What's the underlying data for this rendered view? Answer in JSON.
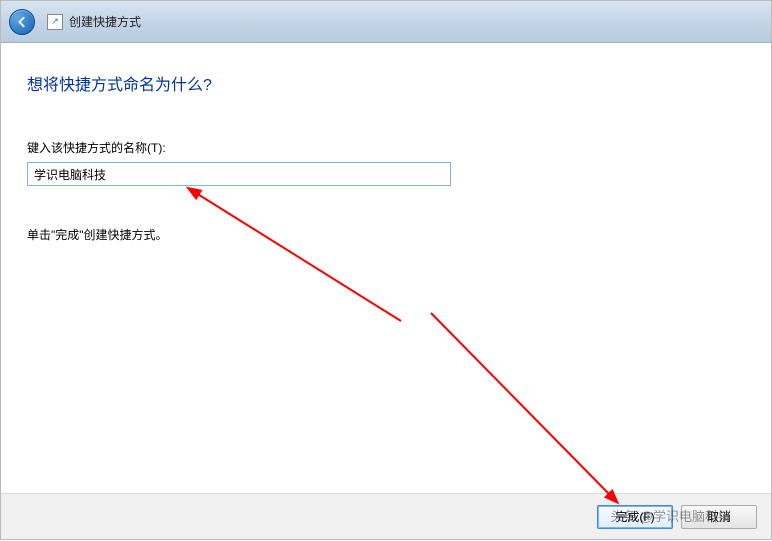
{
  "titlebar": {
    "title": "创建快捷方式"
  },
  "wizard": {
    "heading": "想将快捷方式命名为什么?",
    "name_label": "键入该快捷方式的名称(T):",
    "name_value": "学识电脑科技",
    "hint": "单击\"完成\"创建快捷方式。"
  },
  "buttons": {
    "finish": "完成(F)",
    "cancel": "取消"
  },
  "watermark": {
    "text": "头条 @学识电脑科技"
  }
}
